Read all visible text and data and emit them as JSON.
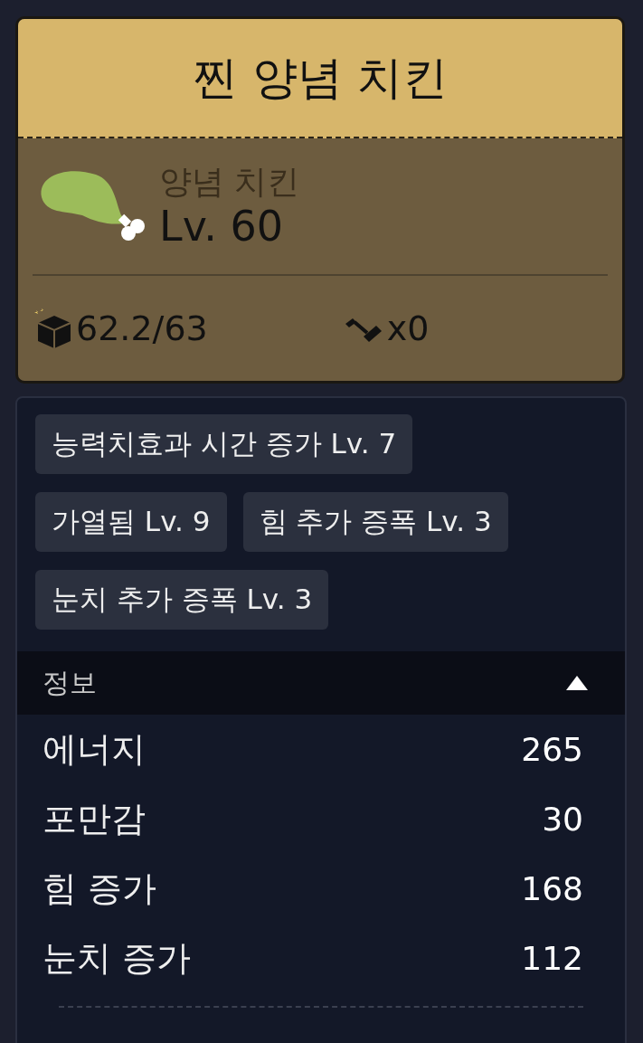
{
  "item": {
    "title": "찐 양념 치킨",
    "category": "양념 치킨",
    "level": "Lv. 60",
    "weight": "62.2/63",
    "count": "x0"
  },
  "tags": [
    {
      "label": "능력치효과 시간 증가  Lv. 7"
    },
    {
      "label": "가열됨 Lv. 9"
    },
    {
      "label": "힘 추가 증폭 Lv. 3"
    },
    {
      "label": "눈치 추가 증폭 Lv. 3"
    }
  ],
  "info": {
    "title": "정보",
    "expanded": true,
    "stats": [
      {
        "name": "에너지",
        "value": "265"
      },
      {
        "name": "포만감",
        "value": "30"
      },
      {
        "name": "힘 증가",
        "value": "168"
      },
      {
        "name": "눈치 증가",
        "value": "112"
      }
    ]
  }
}
